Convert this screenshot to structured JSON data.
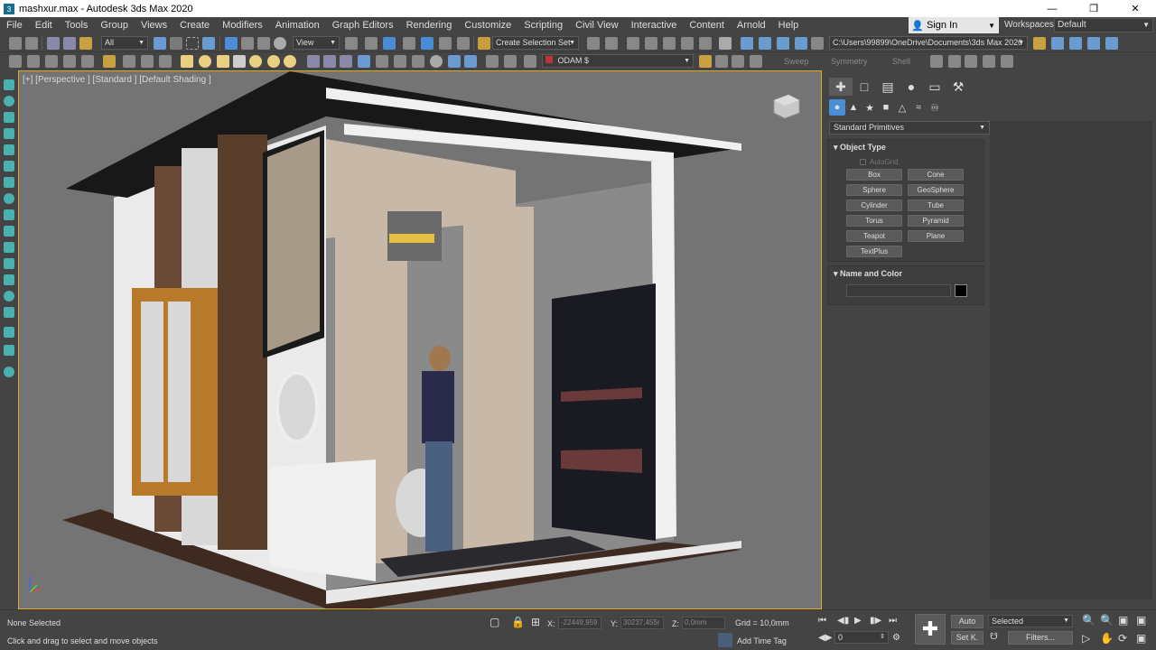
{
  "window": {
    "title": "mashxur.max - Autodesk 3ds Max 2020",
    "minimize": "—",
    "maximize": "❐",
    "close": "✕"
  },
  "menu": [
    "File",
    "Edit",
    "Tools",
    "Group",
    "Views",
    "Create",
    "Modifiers",
    "Animation",
    "Graph Editors",
    "Rendering",
    "Customize",
    "Scripting",
    "Civil View",
    "Interactive",
    "Content",
    "Arnold",
    "Help"
  ],
  "signin": {
    "label": "Sign In"
  },
  "workspaces": {
    "label": "Workspaces:",
    "value": "Default"
  },
  "toolbar": {
    "selection_filter": "All",
    "ref_coord": "View",
    "named_selection": "Create Selection Set",
    "project_path": "C:\\Users\\99899\\OneDrive\\Documents\\3ds Max 2020"
  },
  "toolbar2": {
    "layer_name": "ODAM $",
    "sweep": "Sweep",
    "symmetry": "Symmetry",
    "shell": "Shell"
  },
  "viewport": {
    "label": "[+] [Perspective ] [Standard ] [Default Shading ]"
  },
  "command_panel": {
    "primitives_dropdown": "Standard Primitives",
    "object_type": {
      "header": "Object Type",
      "autogrid": "AutoGrid",
      "buttons": [
        "Box",
        "Cone",
        "Sphere",
        "GeoSphere",
        "Cylinder",
        "Tube",
        "Torus",
        "Pyramid",
        "Teapot",
        "Plane",
        "TextPlus"
      ]
    },
    "name_color": {
      "header": "Name and Color",
      "color": "#000000"
    }
  },
  "status": {
    "selection": "None Selected",
    "prompt": "Click and drag to select and move objects",
    "x_label": "X:",
    "x_value": "-22449,959",
    "y_label": "Y:",
    "y_value": "30237,455r",
    "z_label": "Z:",
    "z_value": "0,0mm",
    "grid": "Grid = 10,0mm",
    "add_time_tag": "Add Time Tag"
  },
  "animation": {
    "auto": "Auto",
    "set_key": "Set K.",
    "selected": "Selected",
    "filters": "Filters...",
    "frame": "0"
  },
  "colors": {
    "accent": "#4a8dd6",
    "viewport_border": "#e3a81f",
    "viewport_bg": "#747474"
  }
}
